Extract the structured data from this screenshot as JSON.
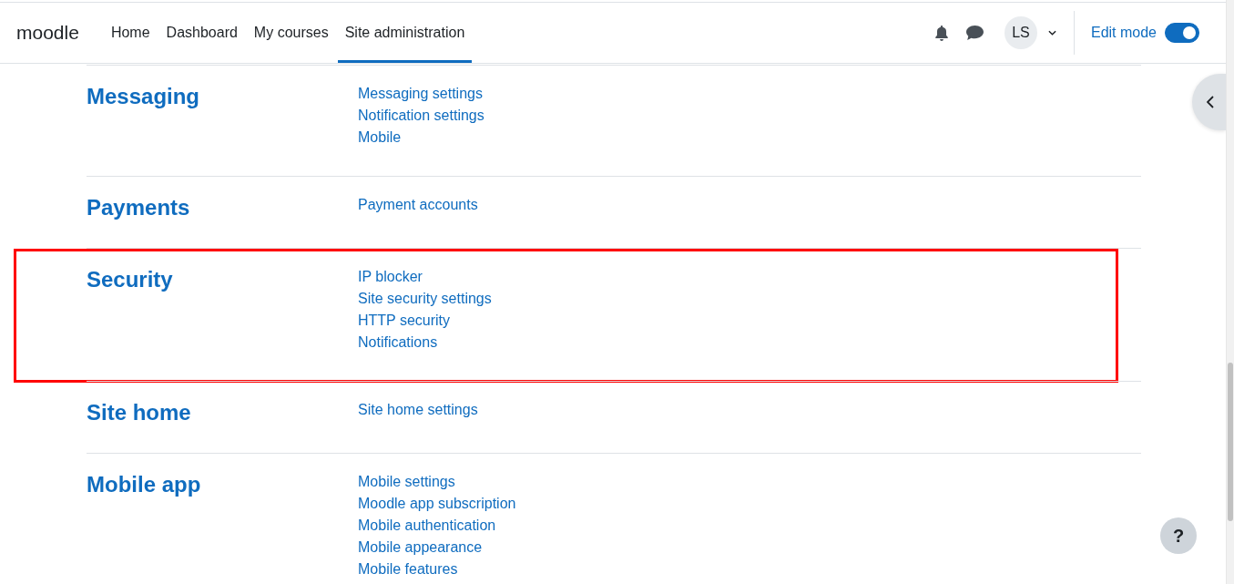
{
  "logo": "moodle",
  "nav": [
    {
      "label": "Home",
      "selected": false
    },
    {
      "label": "Dashboard",
      "selected": false
    },
    {
      "label": "My courses",
      "selected": false
    },
    {
      "label": "Site administration",
      "selected": true
    }
  ],
  "user": {
    "initials": "LS"
  },
  "edit_mode": {
    "label": "Edit mode",
    "on": true
  },
  "sections": [
    {
      "title": "Messaging",
      "highlighted": false,
      "links": [
        "Messaging settings",
        "Notification settings",
        "Mobile"
      ]
    },
    {
      "title": "Payments",
      "highlighted": false,
      "links": [
        "Payment accounts"
      ]
    },
    {
      "title": "Security",
      "highlighted": true,
      "links": [
        "IP blocker",
        "Site security settings",
        "HTTP security",
        "Notifications"
      ]
    },
    {
      "title": "Site home",
      "highlighted": false,
      "links": [
        "Site home settings"
      ]
    },
    {
      "title": "Mobile app",
      "highlighted": false,
      "links": [
        "Mobile settings",
        "Moodle app subscription",
        "Mobile authentication",
        "Mobile appearance",
        "Mobile features"
      ]
    }
  ],
  "help_button": {
    "label": "?"
  }
}
